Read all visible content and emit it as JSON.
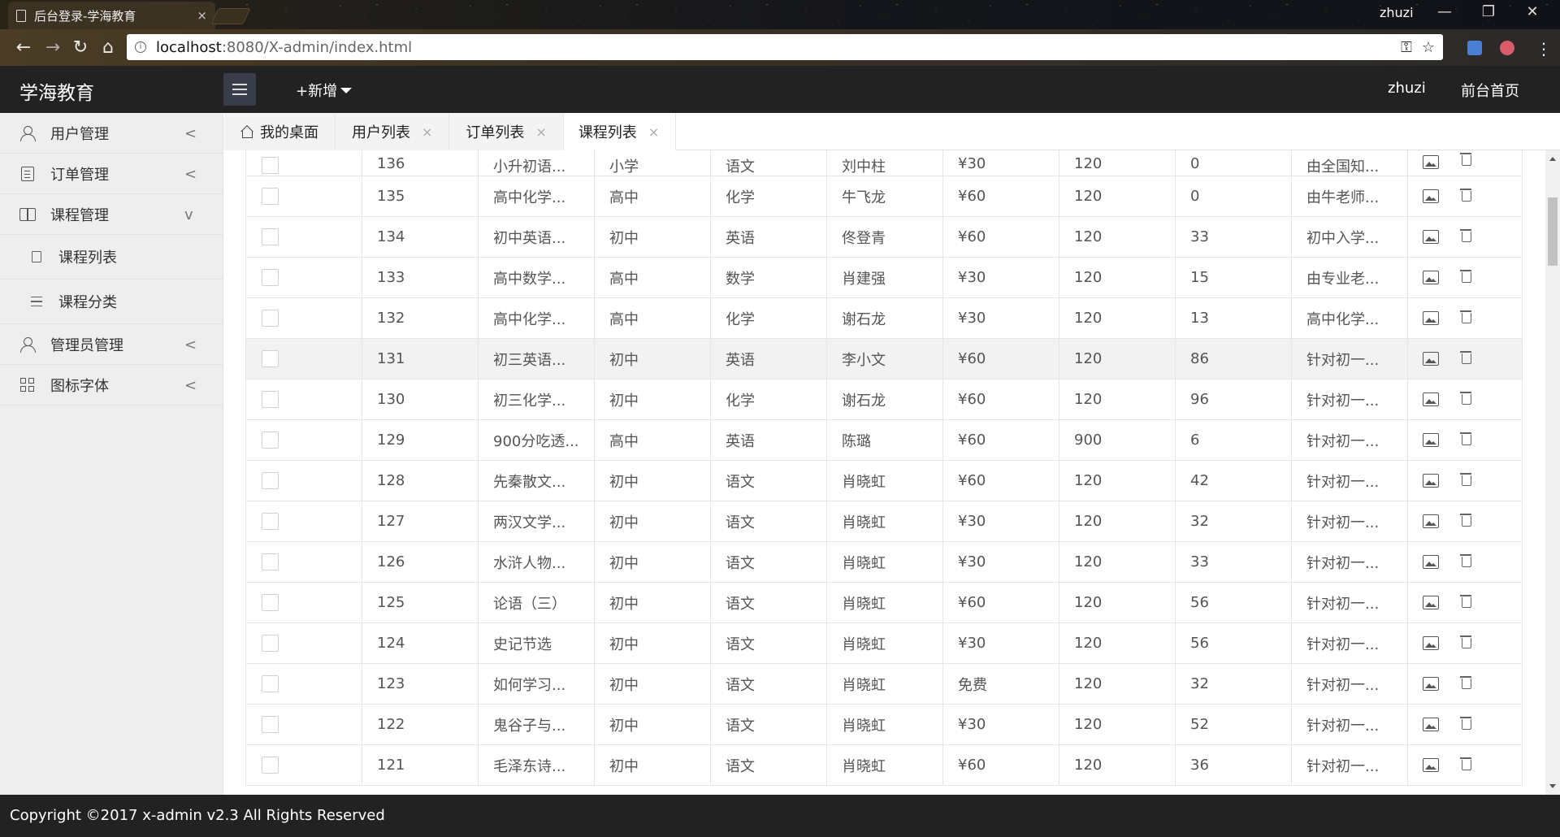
{
  "browser": {
    "tab_title": "后台登录-学海教育",
    "tab_close": "×",
    "profile_name": "zhuzi",
    "window_controls": [
      "—",
      "❐",
      "✕"
    ],
    "url_host": "localhost",
    "url_path": ":8080/X-admin/index.html",
    "nav_icons": [
      "back-icon",
      "forward-icon",
      "reload-icon",
      "home-icon"
    ]
  },
  "header": {
    "logo": "学海教育",
    "add_label": "+新增",
    "user": "zhuzi",
    "front_link": "前台首页"
  },
  "sidebar": {
    "items": [
      {
        "label": "用户管理",
        "chevron": "<"
      },
      {
        "label": "订单管理",
        "chevron": "<"
      },
      {
        "label": "课程管理",
        "chevron": "v"
      },
      {
        "label": "课程列表"
      },
      {
        "label": "课程分类"
      },
      {
        "label": "管理员管理",
        "chevron": "<"
      },
      {
        "label": "图标字体",
        "chevron": "<"
      }
    ]
  },
  "tabs": [
    {
      "label": "我的桌面"
    },
    {
      "label": "用户列表",
      "close": "×"
    },
    {
      "label": "订单列表",
      "close": "×"
    },
    {
      "label": "课程列表",
      "close": "×"
    }
  ],
  "rows": [
    {
      "id": "136",
      "name": "小升初语...",
      "level": "小学",
      "subject": "语文",
      "teacher": "刘中柱",
      "price": "¥30",
      "duration": "120",
      "count": "0",
      "desc": "由全国知..."
    },
    {
      "id": "135",
      "name": "高中化学...",
      "level": "高中",
      "subject": "化学",
      "teacher": "牛飞龙",
      "price": "¥60",
      "duration": "120",
      "count": "0",
      "desc": "由牛老师..."
    },
    {
      "id": "134",
      "name": "初中英语...",
      "level": "初中",
      "subject": "英语",
      "teacher": "佟登青",
      "price": "¥60",
      "duration": "120",
      "count": "33",
      "desc": "初中入学..."
    },
    {
      "id": "133",
      "name": "高中数学...",
      "level": "高中",
      "subject": "数学",
      "teacher": "肖建强",
      "price": "¥30",
      "duration": "120",
      "count": "15",
      "desc": "由专业老..."
    },
    {
      "id": "132",
      "name": "高中化学...",
      "level": "高中",
      "subject": "化学",
      "teacher": "谢石龙",
      "price": "¥30",
      "duration": "120",
      "count": "13",
      "desc": "高中化学..."
    },
    {
      "id": "131",
      "name": "初三英语...",
      "level": "初中",
      "subject": "英语",
      "teacher": "李小文",
      "price": "¥60",
      "duration": "120",
      "count": "86",
      "desc": "针对初一..."
    },
    {
      "id": "130",
      "name": "初三化学...",
      "level": "初中",
      "subject": "化学",
      "teacher": "谢石龙",
      "price": "¥60",
      "duration": "120",
      "count": "96",
      "desc": "针对初一..."
    },
    {
      "id": "129",
      "name": "900分吃透...",
      "level": "高中",
      "subject": "英语",
      "teacher": "陈璐",
      "price": "¥60",
      "duration": "900",
      "count": "6",
      "desc": "针对初一..."
    },
    {
      "id": "128",
      "name": "先秦散文...",
      "level": "初中",
      "subject": "语文",
      "teacher": "肖晓虹",
      "price": "¥60",
      "duration": "120",
      "count": "42",
      "desc": "针对初一..."
    },
    {
      "id": "127",
      "name": "两汉文学...",
      "level": "初中",
      "subject": "语文",
      "teacher": "肖晓虹",
      "price": "¥30",
      "duration": "120",
      "count": "32",
      "desc": "针对初一..."
    },
    {
      "id": "126",
      "name": "水浒人物...",
      "level": "初中",
      "subject": "语文",
      "teacher": "肖晓虹",
      "price": "¥30",
      "duration": "120",
      "count": "33",
      "desc": "针对初一..."
    },
    {
      "id": "125",
      "name": "论语（三）",
      "level": "初中",
      "subject": "语文",
      "teacher": "肖晓虹",
      "price": "¥60",
      "duration": "120",
      "count": "56",
      "desc": "针对初一..."
    },
    {
      "id": "124",
      "name": "史记节选",
      "level": "初中",
      "subject": "语文",
      "teacher": "肖晓虹",
      "price": "¥30",
      "duration": "120",
      "count": "56",
      "desc": "针对初一..."
    },
    {
      "id": "123",
      "name": "如何学习...",
      "level": "初中",
      "subject": "语文",
      "teacher": "肖晓虹",
      "price": "免费",
      "duration": "120",
      "count": "32",
      "desc": "针对初一..."
    },
    {
      "id": "122",
      "name": "鬼谷子与...",
      "level": "初中",
      "subject": "语文",
      "teacher": "肖晓虹",
      "price": "¥30",
      "duration": "120",
      "count": "52",
      "desc": "针对初一..."
    },
    {
      "id": "121",
      "name": "毛泽东诗...",
      "level": "初中",
      "subject": "语文",
      "teacher": "肖晓虹",
      "price": "¥60",
      "duration": "120",
      "count": "36",
      "desc": "针对初一..."
    }
  ],
  "row_actions": [
    "image-icon",
    "trash-icon"
  ],
  "footer": {
    "copyright": "Copyright ©2017 x-admin v2.3 All Rights Reserved"
  }
}
